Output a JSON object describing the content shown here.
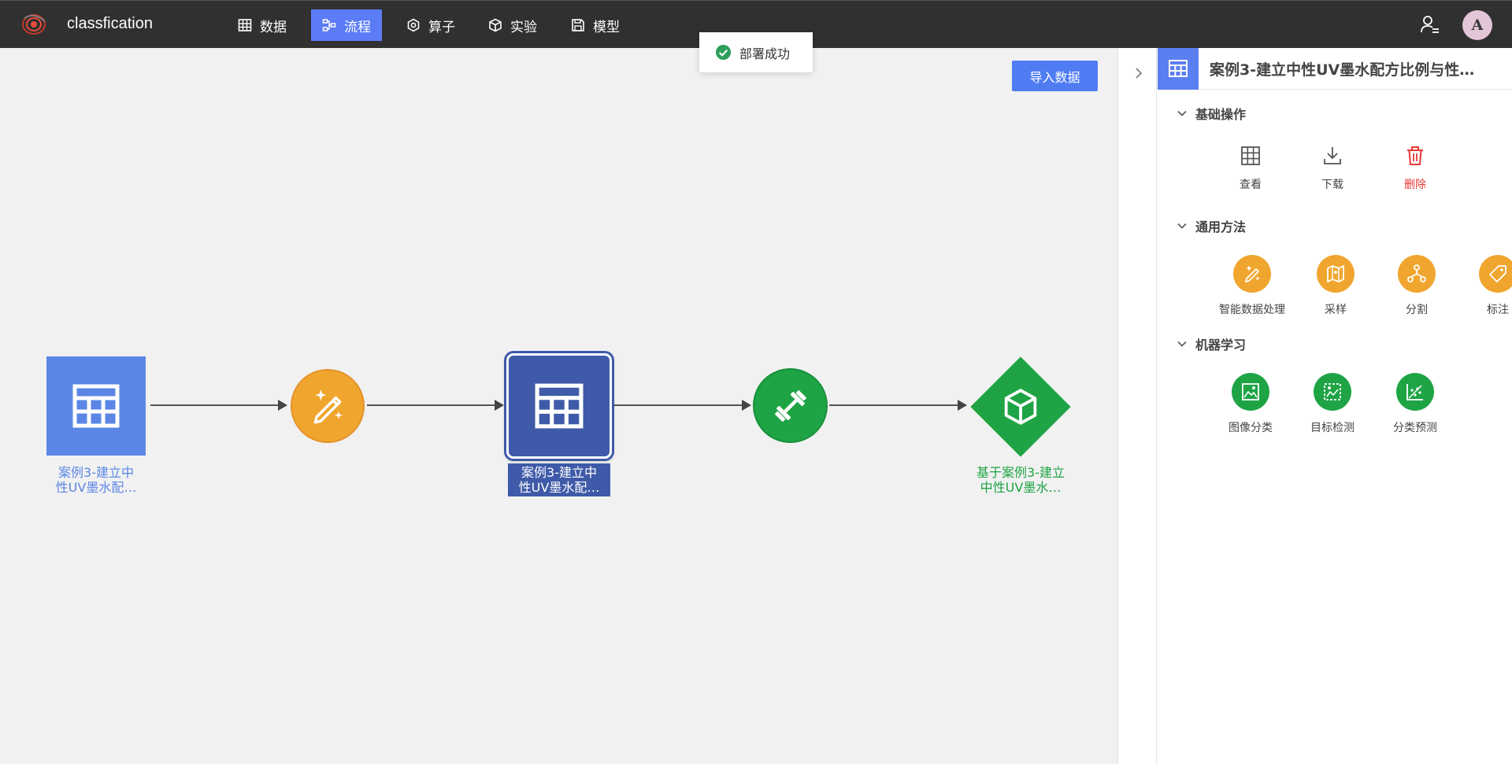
{
  "app": {
    "title": "classfication"
  },
  "nav": [
    {
      "label": "数据",
      "icon": "table-icon"
    },
    {
      "label": "流程",
      "icon": "flow-icon",
      "active": true
    },
    {
      "label": "算子",
      "icon": "hexagon-icon"
    },
    {
      "label": "实验",
      "icon": "cube-icon"
    },
    {
      "label": "模型",
      "icon": "save-icon"
    }
  ],
  "user": {
    "avatar_letter": "A"
  },
  "toast": {
    "message": "部署成功"
  },
  "canvas": {
    "import_button": "导入数据",
    "nodes": [
      {
        "label": "案例3-建立中性UV墨水配…",
        "label_line1": "案例3-建立中",
        "label_line2": "性UV墨水配…",
        "type": "dataset",
        "icon": "table-icon",
        "color": "#5b86e5"
      },
      {
        "type": "data-processing",
        "icon": "magic-pencil-icon",
        "color": "#f0a62e"
      },
      {
        "label": "案例3-建立中性UV墨水配…",
        "label_line1": "案例3-建立中",
        "label_line2": "性UV墨水配…",
        "type": "dataset",
        "icon": "table-icon",
        "color": "#3f5aa8",
        "selected": true
      },
      {
        "type": "training",
        "icon": "dumbbell-icon",
        "color": "#1ea445"
      },
      {
        "label": "基于案例3-建立中性UV墨水…",
        "label_line1": "基于案例3-建立",
        "label_line2": "中性UV墨水…",
        "type": "model",
        "icon": "cube-icon",
        "color": "#1ea445"
      }
    ]
  },
  "panel": {
    "title": "案例3-建立中性UV墨水配方比例与性…",
    "sections": [
      {
        "title": "基础操作",
        "actions": [
          {
            "label": "查看",
            "icon": "table-icon"
          },
          {
            "label": "下载",
            "icon": "download-icon"
          },
          {
            "label": "删除",
            "icon": "trash-icon",
            "color": "#e53935"
          }
        ]
      },
      {
        "title": "通用方法",
        "actions": [
          {
            "label": "智能数据处理",
            "icon": "magic-pencil-icon"
          },
          {
            "label": "采样",
            "icon": "map-icon"
          },
          {
            "label": "分割",
            "icon": "split-icon"
          },
          {
            "label": "标注",
            "icon": "tag-icon"
          }
        ]
      },
      {
        "title": "机器学习",
        "actions": [
          {
            "label": "图像分类",
            "icon": "image-classify-icon"
          },
          {
            "label": "目标检测",
            "icon": "object-detect-icon"
          },
          {
            "label": "分类预测",
            "icon": "scatter-predict-icon"
          }
        ]
      }
    ]
  },
  "colors": {
    "accent": "#5b7cf6",
    "orange": "#f0a62e",
    "green": "#1ea445",
    "dark_node": "#3f5aa8",
    "delete": "#e53935"
  }
}
